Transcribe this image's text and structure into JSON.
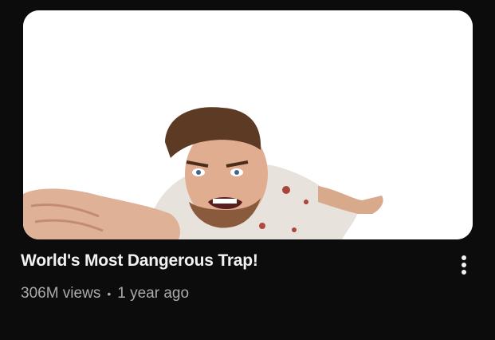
{
  "video": {
    "title": "World's Most Dangerous Trap!",
    "views": "306M views",
    "separator": "•",
    "age": "1 year ago",
    "thumbnail_alt": "video-thumbnail"
  },
  "icons": {
    "more": "more-vert-icon"
  },
  "colors": {
    "background": "#0c0c0c",
    "title": "#f1f1f1",
    "meta": "#aaaaaa",
    "thumbnail_bg": "#ffffff"
  }
}
